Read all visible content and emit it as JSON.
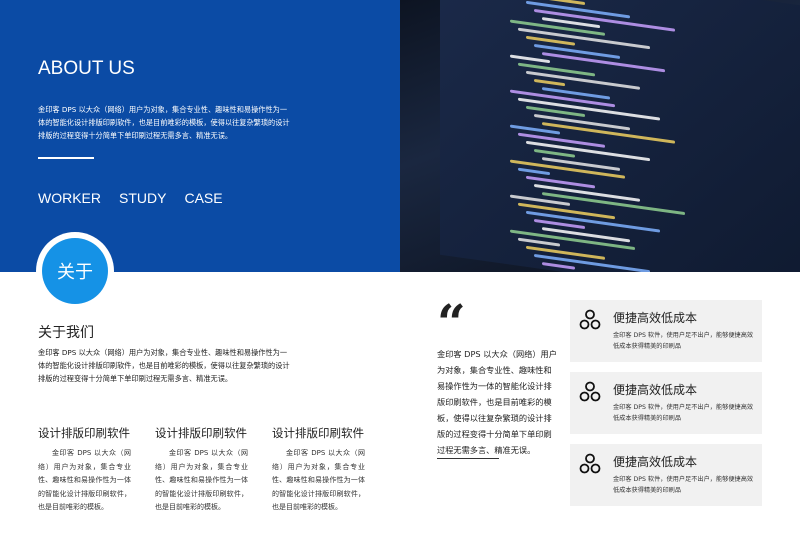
{
  "hero": {
    "title": "ABOUT US",
    "text": "金印客 DPS 以大众（网络）用户为对象，集合专业性、趣味性和易操作性为一体的智能化设计排版印刷软件，也是目前唯彩的模板，使得以往复杂繁琐的设计排版的过程变得十分简单下单印刷过程无需多言、精准无误。",
    "nav": [
      "WORKER",
      "STUDY",
      "CASE"
    ],
    "accent": "#0b4ba5"
  },
  "badge": {
    "label": "关于",
    "color": "#1592e6"
  },
  "about": {
    "title": "关于我们",
    "text": "金印客 DPS 以大众（网络）用户为对象，集合专业性、趣味性和易操作性为一体的智能化设计排版印刷软件，也是目前唯彩的模板，使得以往复杂繁琐的设计排版的过程变得十分简单下单印刷过程无需多言、精准无误。"
  },
  "columns": [
    {
      "title": "设计排版印刷软件",
      "text": "金印客 DPS 以大众（网络）用户为对象，集合专业性、趣味性和易操作性为一体的智能化设计排版印刷软件，也是目前唯彩的模板。"
    },
    {
      "title": "设计排版印刷软件",
      "text": "金印客 DPS 以大众（网络）用户为对象，集合专业性、趣味性和易操作性为一体的智能化设计排版印刷软件，也是目前唯彩的模板。"
    },
    {
      "title": "设计排版印刷软件",
      "text": "金印客 DPS 以大众（网络）用户为对象，集合专业性、趣味性和易操作性为一体的智能化设计排版印刷软件，也是目前唯彩的模板。"
    }
  ],
  "quote": {
    "mark": "“",
    "text": "金印客 DPS 以大众（网络）用户为对象，集合专业性、趣味性和易操作性为一体的智能化设计排版印刷软件，也是目前唯彩的模板，使得以往复杂繁琐的设计排版的过程变得十分简单下单印刷过程无需多言、精准无误。"
  },
  "cards": [
    {
      "icon": "circles-icon",
      "title": "便捷高效低成本",
      "text": "金印客 DPS 软件，使用户足不出户，能够便捷高效低成本获得精美的印刷品"
    },
    {
      "icon": "circles-icon",
      "title": "便捷高效低成本",
      "text": "金印客 DPS 软件，使用户足不出户，能够便捷高效低成本获得精美的印刷品"
    },
    {
      "icon": "circles-icon",
      "title": "便捷高效低成本",
      "text": "金印客 DPS 软件，使用户足不出户，能够便捷高效低成本获得精美的印刷品"
    }
  ]
}
